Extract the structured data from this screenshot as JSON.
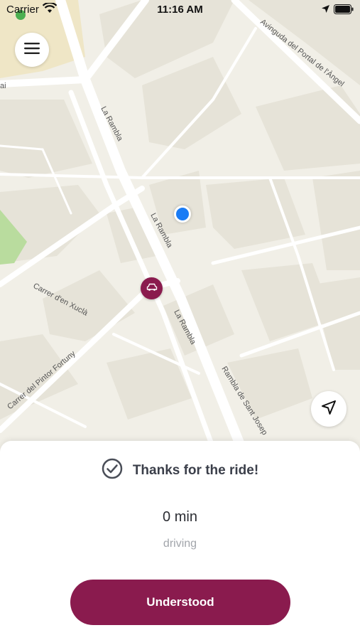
{
  "status_bar": {
    "carrier": "Carrier",
    "time": "11:16 AM"
  },
  "map": {
    "labels": {
      "la_rambla_top": "La Rambla",
      "la_rambla_mid": "La Rambla",
      "la_rambla_low": "La Rambla",
      "carrer_xucla": "Carrer d'en Xuclà",
      "pintor_fortuny": "Carrer del Pintor Fortuny",
      "rambla_sant_josep": "Rambla de Sant Josep",
      "avinguda_portal": "Avinguda del Portal de l'Àngel",
      "cut_label": "ai"
    },
    "colors": {
      "background": "#f1efe7",
      "block": "#e6e3d8",
      "road": "#ffffff",
      "park": "#b9dc9e",
      "user_location": "#1a7cf5",
      "car_marker": "#8a1b4e"
    }
  },
  "ride_sheet": {
    "title": "Thanks for the ride!",
    "eta": "0 min",
    "mode": "driving",
    "button_label": "Understood",
    "accent_color": "#8a1b4e"
  },
  "icons": {
    "menu": "hamburger-menu-icon",
    "locate": "navigation-arrow-icon",
    "car": "car-icon",
    "check": "check-circle-icon"
  }
}
